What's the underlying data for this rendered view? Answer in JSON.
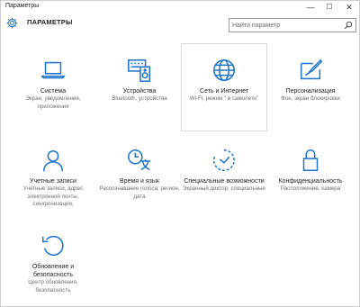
{
  "window": {
    "title": "Параметры",
    "minimize_glyph": "—",
    "maximize_glyph": "☐",
    "close_glyph": "✕"
  },
  "header": {
    "title": "ПАРАМЕТРЫ",
    "icon": "gear-icon"
  },
  "search": {
    "placeholder": "Найти параметр",
    "value": "",
    "icon": "search-icon"
  },
  "colors": {
    "accent": "#1e73c8",
    "text": "#222222",
    "description": "#6e6e6e"
  },
  "tiles": [
    {
      "label": "Система",
      "description": "Экран, уведомления, приложения",
      "icon": "laptop-icon",
      "selected": false
    },
    {
      "label": "Устройства",
      "description": "Bluetooth, устройства",
      "icon": "devices-icon",
      "selected": false
    },
    {
      "label": "Сеть и Интернет",
      "description": "Wi-Fi, режим \" в самолете\"",
      "icon": "globe-icon",
      "selected": true
    },
    {
      "label": "Персонализация",
      "description": "Фон, экран блокировки",
      "icon": "paint-icon",
      "selected": false
    },
    {
      "label": "Учетные записи",
      "description": "Учетные записи, адрес электронной почты, синхронизация,",
      "icon": "user-icon",
      "selected": false
    },
    {
      "label": "Время и язык",
      "description": "Распознавание голоса, регион, дата",
      "icon": "time-language-icon",
      "selected": false
    },
    {
      "label": "Специальные возможности",
      "description": "Экранный диктор, специальные",
      "icon": "ease-of-access-icon",
      "selected": false
    },
    {
      "label": "Конфиденциальность",
      "description": "Расположение, камера",
      "icon": "lock-icon",
      "selected": false
    },
    {
      "label": "Обновление и безопасность",
      "description": "Центр обновления, безопасность",
      "icon": "update-icon",
      "selected": false
    }
  ]
}
